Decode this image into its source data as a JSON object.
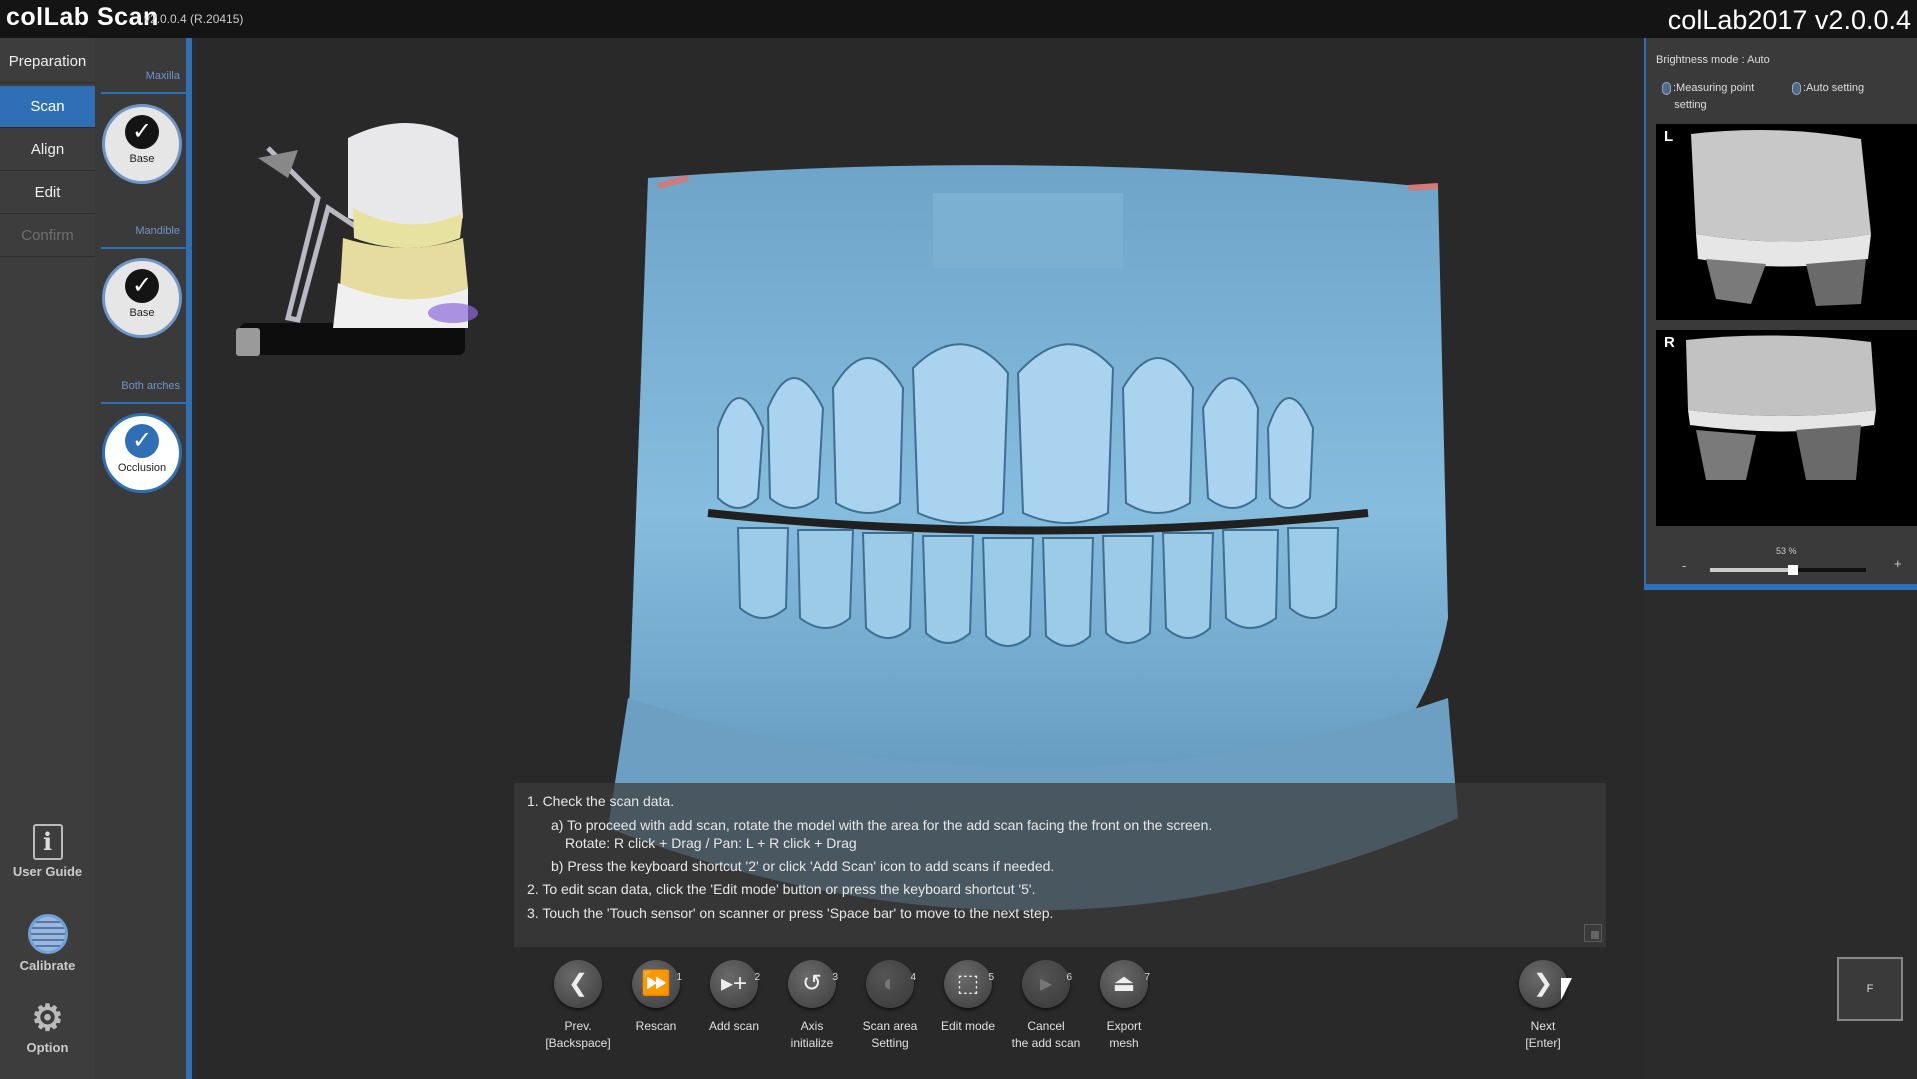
{
  "header": {
    "logo": "colLab Scan",
    "version": "v2.0.0.4  (R.20415)",
    "title": "colLab2017 v2.0.0.4"
  },
  "nav": {
    "items": [
      {
        "label": "Preparation",
        "state": "normal"
      },
      {
        "label": "Scan",
        "state": "active"
      },
      {
        "label": "Align",
        "state": "normal"
      },
      {
        "label": "Edit",
        "state": "normal"
      },
      {
        "label": "Confirm",
        "state": "disabled"
      }
    ],
    "user_guide": "User Guide",
    "calibrate": "Calibrate",
    "option": "Option"
  },
  "steps": {
    "maxilla_label": "Maxilla",
    "maxilla_step": "Base",
    "mandible_label": "Mandible",
    "mandible_step": "Base",
    "both_label": "Both arches",
    "both_step": "Occlusion"
  },
  "instructions": {
    "l1": "1. Check the scan data.",
    "l2": "a) To proceed with add scan, rotate the model with the area for the add scan facing the front on the screen.",
    "l3": "Rotate: R click + Drag / Pan: L + R click + Drag",
    "l4": "b) Press the keyboard shortcut '2' or click 'Add Scan' icon to add scans if needed.",
    "l5": "2. To edit scan data, click the 'Edit mode' button or press the keyboard shortcut '5'.",
    "l6": "3. Touch the 'Touch sensor' on scanner or press 'Space bar' to move to the next step."
  },
  "toolbar": {
    "prev": "Prev.\n[Backspace]",
    "rescan": "Rescan",
    "rescan_num": "1",
    "add_scan": "Add scan",
    "add_scan_num": "2",
    "axis": "Axis\ninitialize",
    "axis_num": "3",
    "scan_area": "Scan area\nSetting",
    "scan_area_num": "4",
    "edit_mode": "Edit mode",
    "edit_mode_num": "5",
    "cancel_add": "Cancel\nthe add scan",
    "cancel_add_num": "6",
    "export": "Export\nmesh",
    "export_num": "7",
    "next": "Next\n[Enter]",
    "f_box": "F"
  },
  "right_panel": {
    "brightness_mode": "Brightness mode : Auto",
    "measuring_point": ":Measuring point\n    setting",
    "auto_setting": ":Auto setting",
    "cam_left": "L",
    "cam_right": "R",
    "zoom_minus": "-",
    "zoom_plus": "+",
    "zoom_value": "53 %",
    "zoom_fraction": 0.53
  },
  "colors": {
    "accent": "#2f6fb6",
    "model": "#7fb3d6",
    "panel": "#3a3a3a"
  }
}
